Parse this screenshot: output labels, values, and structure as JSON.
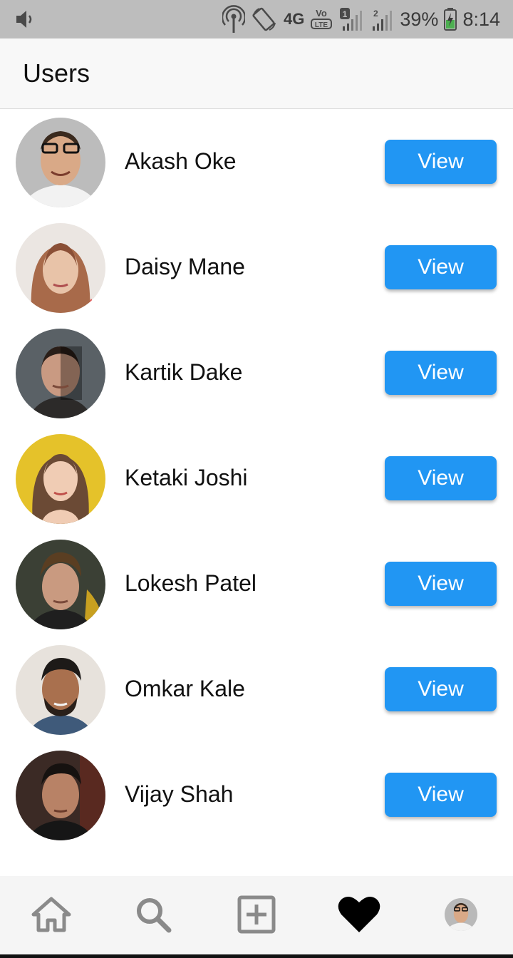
{
  "status_bar": {
    "icons": [
      "volume-icon",
      "hotspot-icon",
      "rotate-icon",
      "signal-icon",
      "battery-icon"
    ],
    "network": "4G",
    "volte": "VoLTE",
    "sim1": "1",
    "sim2": "2",
    "battery": "39%",
    "time": "8:14"
  },
  "app_bar": {
    "title": "Users"
  },
  "users": [
    {
      "name": "Akash Oke",
      "button": "View",
      "avatar_bg": "#b9b9b9"
    },
    {
      "name": "Daisy Mane",
      "button": "View",
      "avatar_bg": "#e8e4e0"
    },
    {
      "name": "Kartik Dake",
      "button": "View",
      "avatar_bg": "#5b6266"
    },
    {
      "name": "Ketaki Joshi",
      "button": "View",
      "avatar_bg": "#e5c22a"
    },
    {
      "name": "Lokesh Patel",
      "button": "View",
      "avatar_bg": "#3d4236"
    },
    {
      "name": "Omkar Kale",
      "button": "View",
      "avatar_bg": "#e7e2dc"
    },
    {
      "name": "Vijay Shah",
      "button": "View",
      "avatar_bg": "#3b2a25"
    }
  ],
  "bottom_nav": {
    "items": [
      "home-icon",
      "search-icon",
      "add-post-icon",
      "heart-icon",
      "profile-avatar"
    ]
  },
  "colors": {
    "accent": "#2196f3",
    "status_bar": "#bdbdbd",
    "nav_icon": "#8a8a8a"
  }
}
